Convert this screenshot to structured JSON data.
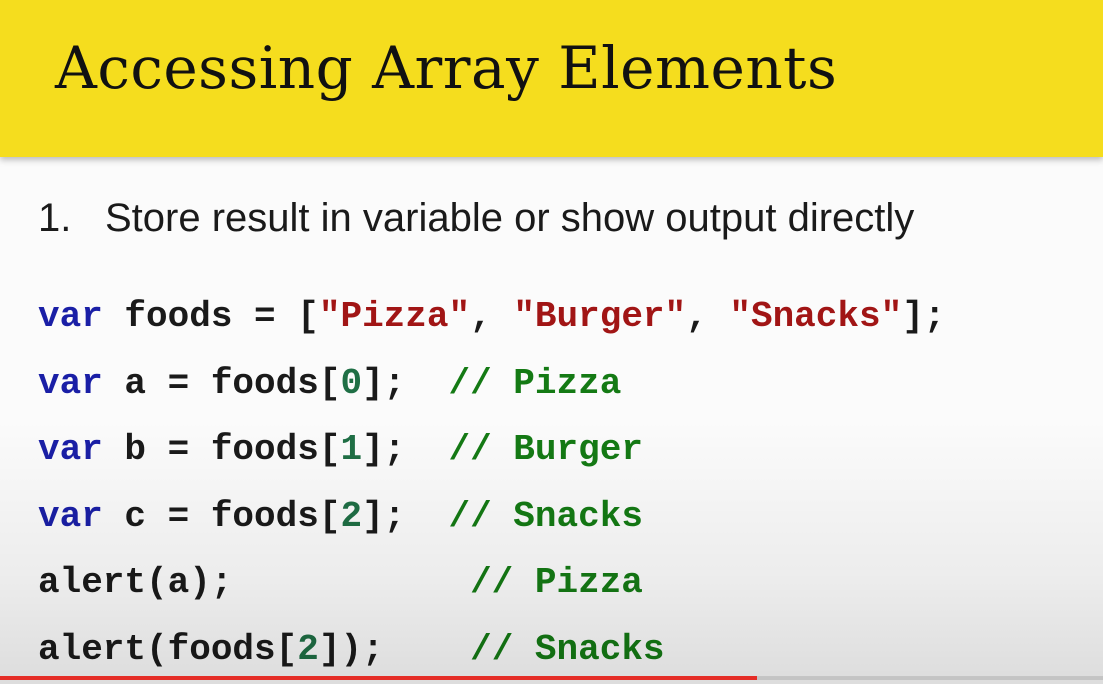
{
  "slide": {
    "title": "Accessing Array Elements",
    "point_number": "1.",
    "point_text": "Store result in variable or show output directly"
  },
  "code": {
    "lines": [
      [
        {
          "t": "var",
          "c": "kw"
        },
        {
          "t": " foods = [",
          "c": ""
        },
        {
          "t": "\"Pizza\"",
          "c": "str"
        },
        {
          "t": ", ",
          "c": ""
        },
        {
          "t": "\"Burger\"",
          "c": "str"
        },
        {
          "t": ", ",
          "c": ""
        },
        {
          "t": "\"Snacks\"",
          "c": "str"
        },
        {
          "t": "];",
          "c": ""
        }
      ],
      [
        {
          "t": "var",
          "c": "kw"
        },
        {
          "t": " a = foods[",
          "c": ""
        },
        {
          "t": "0",
          "c": "num-lit"
        },
        {
          "t": "];  ",
          "c": ""
        },
        {
          "t": "// Pizza",
          "c": "cmt"
        }
      ],
      [
        {
          "t": "var",
          "c": "kw"
        },
        {
          "t": " b = foods[",
          "c": ""
        },
        {
          "t": "1",
          "c": "num-lit"
        },
        {
          "t": "];  ",
          "c": ""
        },
        {
          "t": "// Burger",
          "c": "cmt"
        }
      ],
      [
        {
          "t": "var",
          "c": "kw"
        },
        {
          "t": " c = foods[",
          "c": ""
        },
        {
          "t": "2",
          "c": "num-lit"
        },
        {
          "t": "];  ",
          "c": ""
        },
        {
          "t": "// Snacks",
          "c": "cmt"
        }
      ],
      [
        {
          "t": "alert(a);",
          "c": ""
        },
        {
          "t": "           ",
          "c": ""
        },
        {
          "t": "// Pizza",
          "c": "cmt"
        }
      ],
      [
        {
          "t": "alert(foods[",
          "c": ""
        },
        {
          "t": "2",
          "c": "num-lit"
        },
        {
          "t": "]);",
          "c": ""
        },
        {
          "t": "    ",
          "c": ""
        },
        {
          "t": "// Snacks",
          "c": "cmt"
        }
      ]
    ]
  },
  "video": {
    "progress_fraction": 0.686
  },
  "colors": {
    "title_bar": "#f5dd1e",
    "keyword": "#1a1fa6",
    "string": "#a11515",
    "number": "#1f6f45",
    "comment": "#147a14",
    "progress": "#e52d27"
  }
}
